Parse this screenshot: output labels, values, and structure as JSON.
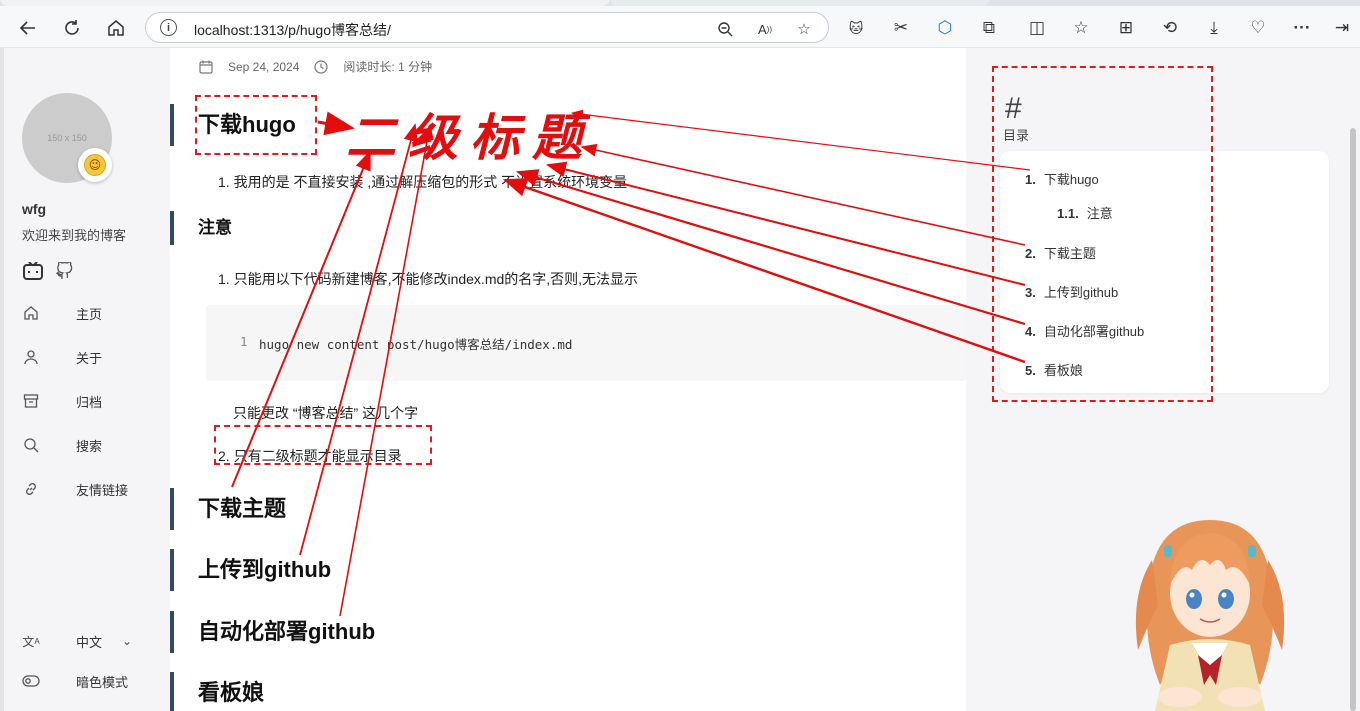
{
  "browser": {
    "url": "localhost:1313/p/hugo博客总结/"
  },
  "sidebar": {
    "avatar_placeholder": "150 x 150",
    "site_name": "wfg",
    "site_desc": "欢迎来到我的博客",
    "menu": [
      {
        "label": "主页",
        "icon": "home-icon"
      },
      {
        "label": "关于",
        "icon": "user-icon"
      },
      {
        "label": "归档",
        "icon": "archive-icon"
      },
      {
        "label": "搜索",
        "icon": "search-icon"
      },
      {
        "label": "友情链接",
        "icon": "link-icon"
      }
    ],
    "language": "中文",
    "dark_mode": "暗色模式"
  },
  "article": {
    "date": "Sep 24, 2024",
    "reading_time": "阅读时长: 1 分钟",
    "h_download_hugo": "下载hugo",
    "item1": "1. 我用的是 不直接安装 ,通过解压缩包的形式 不设置系统环境变量",
    "h_notice": "注意",
    "item2": "1. 只能用以下代码新建博客,不能修改index.md的名字,否则,无法显示",
    "code_line_no": "1",
    "code_line": "hugo new content post/hugo博客总结/index.md",
    "note": "只能更改 “博客总结” 这几个字",
    "item3": "2. 只有二级标题才能显示目录",
    "h_theme": "下载主题",
    "h_github": "上传到github",
    "h_deploy": "自动化部署github",
    "h_mascot": "看板娘"
  },
  "toc": {
    "title": "目录",
    "items": [
      {
        "num": "1.",
        "label": "下载hugo"
      },
      {
        "num": "1.1.",
        "label": "注意"
      },
      {
        "num": "2.",
        "label": "下载主题"
      },
      {
        "num": "3.",
        "label": "上传到github"
      },
      {
        "num": "4.",
        "label": "自动化部署github"
      },
      {
        "num": "5.",
        "label": "看板娘"
      }
    ]
  },
  "annotation": {
    "text": "二级标题",
    "color": "#e30d0d"
  }
}
